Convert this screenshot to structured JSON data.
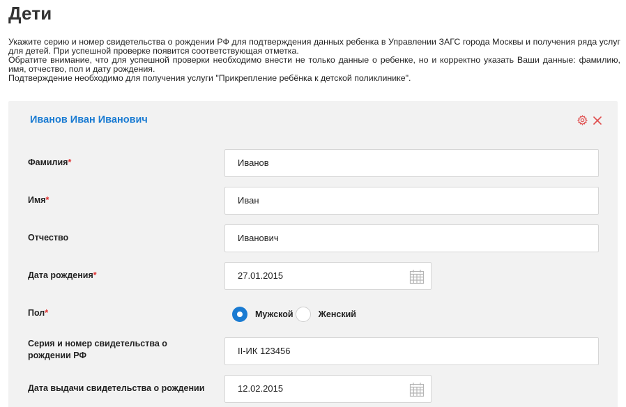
{
  "page": {
    "title": "Дети"
  },
  "intro": {
    "p1": "Укажите серию и номер свидетельства о рождении РФ для подтверждения данных ребенка в Управлении ЗАГС города Москвы и получения ряда услуг для детей. При успешной проверке появится соответствующая отметка.",
    "p2": "Обратите внимание, что для успешной проверки необходимо внести не только данные о ребенке, но и корректно указать Ваши данные: фамилию, имя, отчество, пол и дату рождения.",
    "p3": "Подтверждение необходимо для получения услуги \"Прикрепление ребёнка к детской поликлинике\"."
  },
  "card": {
    "child_name": "Иванов Иван Иванович",
    "settings_icon": "gear-icon",
    "close_icon": "close-icon",
    "accent_color": "#1a7bd2",
    "danger_color": "#e05050"
  },
  "form": {
    "surname": {
      "label": "Фамилия",
      "required_mark": "*",
      "value": "Иванов"
    },
    "name": {
      "label": "Имя",
      "required_mark": "*",
      "value": "Иван"
    },
    "patronymic": {
      "label": "Отчество",
      "value": "Иванович"
    },
    "birth_date": {
      "label": "Дата рождения",
      "required_mark": "*",
      "value": "27.01.2015",
      "icon": "calendar-icon"
    },
    "gender": {
      "label": "Пол",
      "required_mark": "*",
      "options": [
        {
          "label": "Мужской",
          "selected": true
        },
        {
          "label": "Женский",
          "selected": false
        }
      ]
    },
    "certificate": {
      "label_line1": "Серия и номер свидетельства о",
      "label_line2": "рождении РФ",
      "value": "II-ИК 123456"
    },
    "issue_date": {
      "label": "Дата выдачи свидетельства о рождении",
      "value": "12.02.2015",
      "icon": "calendar-icon"
    }
  }
}
